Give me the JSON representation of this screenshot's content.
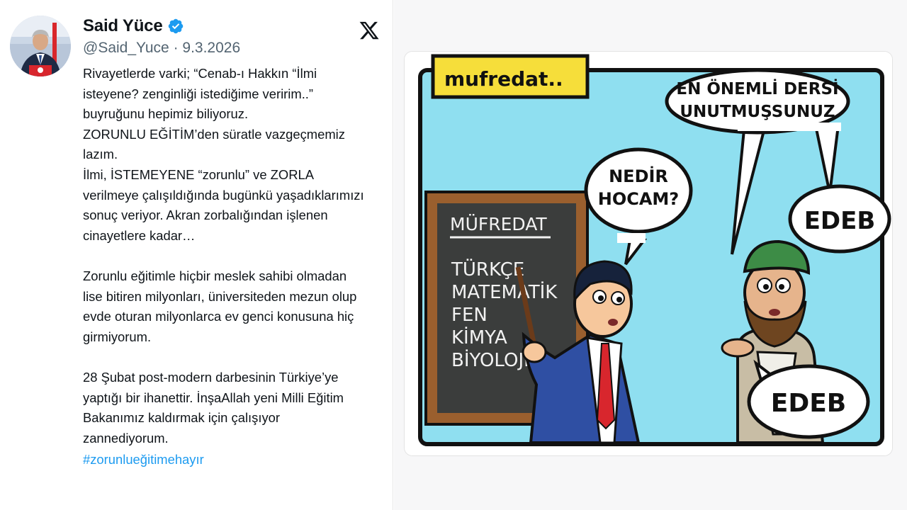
{
  "tweet": {
    "author_name": "Said Yüce",
    "handle_date": "@Said_Yuce · 9.3.2026",
    "text": "Rivayetlerde varki; “Cenab-ı Hakkın  “İlmi\nisteyene? zenginliği istediğime veririm..”\nbuyruğunu hepimiz biliyoruz.\nZORUNLU EĞİTİM’den süratle vazgeçmemiz\nlazım.\nİlmi, İSTEMEYENE “zorunlu” ve ZORLA\nverilmeye çalışıldığında bugünkü yaşadıklarımızı\nsonuç veriyor. Akran zorbalığından işlenen\ncinayetlere kadar…\n\nZorunlu eğitimle hiçbir meslek sahibi olmadan\nlise bitiren milyonları, üniversiteden mezun olup\nevde oturan milyonlarca ev genci konusuna hiç\ngirmiyorum.\n\n28 Şubat post-modern darbesinin Türkiye’ye\nyaptığı bir ihanettir. İnşaAllah yeni Milli Eğitim\nBakanımız kaldırmak için çalışıyor\nzannediyorum.",
    "hashtag": "#zorunlueğitimehayır"
  },
  "icons": {
    "verified": "verified-badge-icon",
    "platform": "x-logo-icon"
  },
  "comic": {
    "title_sign": "mufredat..",
    "board_header": "MÜFREDAT",
    "board_subjects": [
      "TÜRKÇE",
      "MATEMATİK",
      "FEN",
      "KİMYA",
      "BİYOLOJİ"
    ],
    "teacher_bubble_line1": "NEDİR",
    "teacher_bubble_line2": "HOCAM?",
    "top_bubble_line1": "EN ÖNEMLİ DERSİ",
    "top_bubble_line2": "UNUTMUŞSUNUZ",
    "edeb_upper": "EDEB",
    "edeb_lower": "EDEB"
  },
  "colors": {
    "link": "#1d9bf0",
    "verified": "#1d9bf0",
    "secondary_text": "#536471",
    "sky": "#8fdff0",
    "sign_yellow": "#f6de3a",
    "chalkboard": "#3b3d3c",
    "board_frame": "#9a5f2e"
  }
}
